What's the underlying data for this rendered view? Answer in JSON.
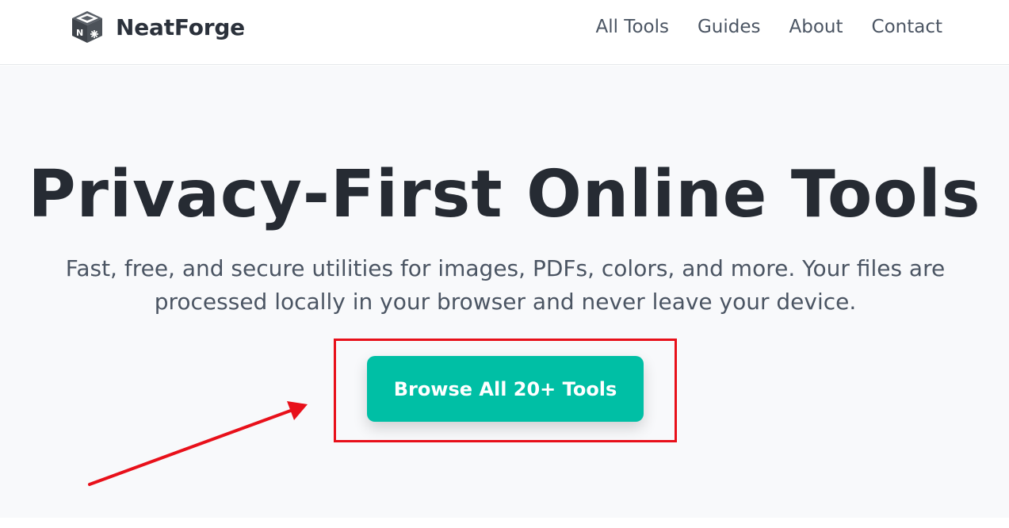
{
  "header": {
    "brand": "NeatForge",
    "logo_icon": "box-cube-icon",
    "nav": [
      {
        "label": "All Tools"
      },
      {
        "label": "Guides"
      },
      {
        "label": "About"
      },
      {
        "label": "Contact"
      }
    ]
  },
  "hero": {
    "title": "Privacy-First Online Tools",
    "subtitle": "Fast, free, and secure utilities for images, PDFs, colors, and more. Your files are processed locally in your browser and never leave your device.",
    "cta_label": "Browse All 20+ Tools"
  },
  "annotation": {
    "highlight_color": "#e8101a",
    "arrow_icon": "red-arrow-icon"
  },
  "colors": {
    "accent": "#00bfa5",
    "heading": "#262b33",
    "text": "#4b5563",
    "hero_bg": "#f8f9fb"
  }
}
